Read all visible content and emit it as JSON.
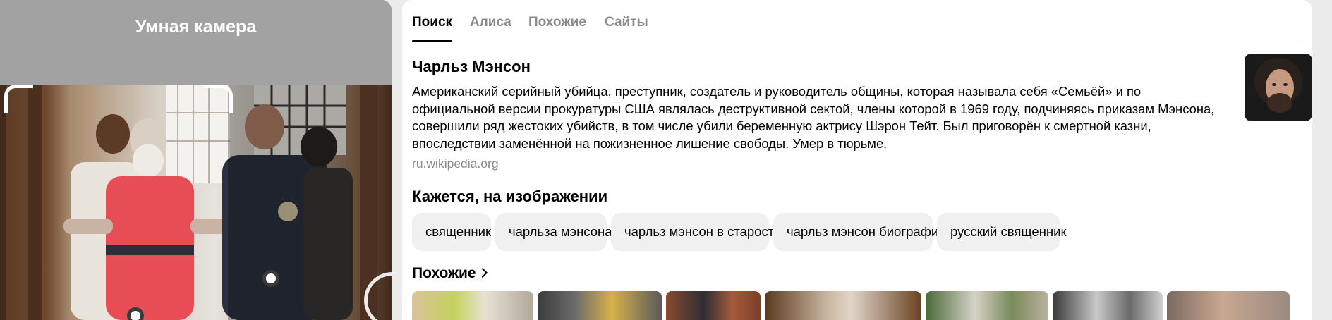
{
  "camera": {
    "title": "Умная камера"
  },
  "tabs": [
    {
      "label": "Поиск",
      "active": true
    },
    {
      "label": "Алиса",
      "active": false
    },
    {
      "label": "Похожие",
      "active": false
    },
    {
      "label": "Сайты",
      "active": false
    }
  ],
  "entity": {
    "title": "Чарльз Мэнсон",
    "description": "Американский серийный убийца, преступник, создатель и руководитель общины, которая называла себя «Семьёй» и по официальной версии прокуратуры США являлась деструктивной сектой, члены которой в 1969 году, подчиняясь приказам Мэнсона, совершили ряд жестоких убийств, в том числе убили беременную актрису Шэрон Тейт. Был приговорён к смертной казни, впоследствии заменённой на пожизненное лишение свободы. Умер в тюрьме.",
    "source": "ru.wikipedia.org"
  },
  "seems": {
    "title": "Кажется, на изображении",
    "chips": [
      "священник",
      "чарльза мэнсона",
      "чарльз мэнсон в старости",
      "чарльз мэнсон биография",
      "русский священник"
    ]
  },
  "similar": {
    "title": "Похожие",
    "icon": "chevron-right-icon"
  },
  "colors": {
    "accent": "#000000",
    "muted": "#8a8a8a",
    "chip_bg": "#f0f0f0",
    "camera_header": "#a2a2a2"
  }
}
